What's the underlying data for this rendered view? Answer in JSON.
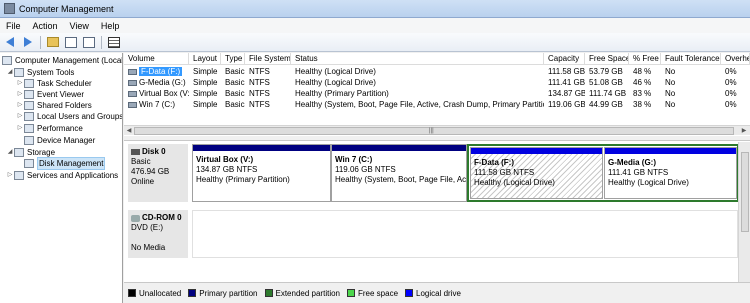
{
  "window": {
    "title": "Computer Management"
  },
  "menu": [
    "File",
    "Action",
    "View",
    "Help"
  ],
  "toolbar": {
    "icons": [
      "back-arrow-icon",
      "forward-arrow-icon",
      "up-folder-icon",
      "show-tree-icon",
      "help-icon",
      "properties-icon"
    ]
  },
  "tree": {
    "root": "Computer Management (Local",
    "system_tools": "System Tools",
    "task_scheduler": "Task Scheduler",
    "event_viewer": "Event Viewer",
    "shared_folders": "Shared Folders",
    "local_users": "Local Users and Groups",
    "performance": "Performance",
    "device_manager": "Device Manager",
    "storage": "Storage",
    "disk_management": "Disk Management",
    "services": "Services and Applications"
  },
  "volumes": {
    "columns": [
      "Volume",
      "Layout",
      "Type",
      "File System",
      "Status",
      "Capacity",
      "Free Space",
      "% Free",
      "Fault Tolerance",
      "Overhea"
    ],
    "rows": [
      [
        "F-Data (F:)",
        "Simple",
        "Basic",
        "NTFS",
        "Healthy (Logical Drive)",
        "111.58 GB",
        "53.79 GB",
        "48 %",
        "No",
        "0%"
      ],
      [
        "G-Media (G:)",
        "Simple",
        "Basic",
        "NTFS",
        "Healthy (Logical Drive)",
        "111.41 GB",
        "51.08 GB",
        "46 %",
        "No",
        "0%"
      ],
      [
        "Virtual Box (V:)",
        "Simple",
        "Basic",
        "NTFS",
        "Healthy (Primary Partition)",
        "134.87 GB",
        "111.74 GB",
        "83 %",
        "No",
        "0%"
      ],
      [
        "Win 7 (C:)",
        "Simple",
        "Basic",
        "NTFS",
        "Healthy (System, Boot, Page File, Active, Crash Dump, Primary Partition)",
        "119.06 GB",
        "44.99 GB",
        "38 %",
        "No",
        "0%"
      ]
    ]
  },
  "disks": {
    "disk0": {
      "name": "Disk 0",
      "type": "Basic",
      "size": "476.94 GB",
      "status": "Online",
      "partitions": [
        {
          "name": "Virtual Box  (V:)",
          "size": "134.87 GB NTFS",
          "status": "Healthy (Primary Partition)"
        },
        {
          "name": "Win 7  (C:)",
          "size": "119.06 GB NTFS",
          "status": "Healthy (System, Boot, Page File, Acti"
        },
        {
          "name": "F-Data  (F:)",
          "size": "111.58 GB NTFS",
          "status": "Healthy (Logical Drive)"
        },
        {
          "name": "G-Media  (G:)",
          "size": "111.41 GB NTFS",
          "status": "Healthy (Logical Drive)"
        }
      ]
    },
    "cdrom0": {
      "name": "CD-ROM 0",
      "type": "DVD (E:)",
      "status": "No Media"
    }
  },
  "legend": [
    {
      "label": "Unallocated",
      "color": "#000000"
    },
    {
      "label": "Primary partition",
      "color": "#00007f"
    },
    {
      "label": "Extended partition",
      "color": "#2d7a2d"
    },
    {
      "label": "Free space",
      "color": "#4cd64c"
    },
    {
      "label": "Logical drive",
      "color": "#0000ff"
    }
  ],
  "colors": {
    "primary_bar": "#000080",
    "logical_bar": "#0000e0",
    "extended_border": "#2d7a2d",
    "selection": "#3399ff"
  }
}
